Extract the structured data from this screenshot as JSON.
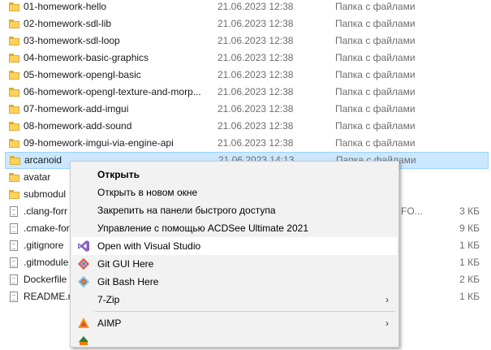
{
  "files": [
    {
      "name": "01-homework-hello",
      "date": "21.06.2023 12:38",
      "type": "Папка с файлами",
      "size": "",
      "icon": "folder-icon"
    },
    {
      "name": "02-homework-sdl-lib",
      "date": "21.06.2023 12:38",
      "type": "Папка с файлами",
      "size": "",
      "icon": "folder-icon"
    },
    {
      "name": "03-homework-sdl-loop",
      "date": "21.06.2023 12:38",
      "type": "Папка с файлами",
      "size": "",
      "icon": "folder-icon"
    },
    {
      "name": "04-homework-basic-graphics",
      "date": "21.06.2023 12:38",
      "type": "Папка с файлами",
      "size": "",
      "icon": "folder-icon"
    },
    {
      "name": "05-homework-opengl-basic",
      "date": "21.06.2023 12:38",
      "type": "Папка с файлами",
      "size": "",
      "icon": "folder-icon"
    },
    {
      "name": "06-homework-opengl-texture-and-morp...",
      "date": "21.06.2023 12:38",
      "type": "Папка с файлами",
      "size": "",
      "icon": "folder-icon"
    },
    {
      "name": "07-homework-add-imgui",
      "date": "21.06.2023 12:38",
      "type": "Папка с файлами",
      "size": "",
      "icon": "folder-icon"
    },
    {
      "name": "08-homework-add-sound",
      "date": "21.06.2023 12:38",
      "type": "Папка с файлами",
      "size": "",
      "icon": "folder-icon"
    },
    {
      "name": "09-homework-imgui-via-engine-api",
      "date": "21.06.2023 12:38",
      "type": "Папка с файлами",
      "size": "",
      "icon": "folder-icon"
    },
    {
      "name": "arcanoid",
      "date": "21.06.2023 14:13",
      "type": "Папка с файлами",
      "size": "",
      "icon": "folder-icon",
      "selected": true
    },
    {
      "name": "avatar",
      "date": "",
      "type": "",
      "size": "",
      "icon": "folder-icon"
    },
    {
      "name": "submodul",
      "date": "",
      "type": "",
      "size": "",
      "icon": "folder-icon"
    },
    {
      "name": ".clang-forr",
      "date": "",
      "type": "FO...",
      "size": "3 КБ",
      "icon": "file-icon"
    },
    {
      "name": ".cmake-for",
      "date": "",
      "type": "",
      "size": "9 КБ",
      "icon": "file-icon"
    },
    {
      "name": ".gitignore",
      "date": "",
      "type": "",
      "size": "1 КБ",
      "icon": "file-icon"
    },
    {
      "name": ".gitmodule",
      "date": "",
      "type": "",
      "size": "1 КБ",
      "icon": "file-icon"
    },
    {
      "name": "Dockerfile",
      "date": "",
      "type": "",
      "size": "2 КБ",
      "icon": "file-icon"
    },
    {
      "name": "README.m",
      "date": "",
      "type": "",
      "size": "1 КБ",
      "icon": "file-icon"
    }
  ],
  "context_menu": {
    "items": [
      {
        "label": "Открыть",
        "bold": true,
        "icon": ""
      },
      {
        "label": "Открыть в новом окне",
        "icon": ""
      },
      {
        "label": "Закрепить на панели быстрого доступа",
        "icon": ""
      },
      {
        "label": "Управление с помощью ACDSee Ultimate 2021",
        "icon": ""
      },
      {
        "label": "Open with Visual Studio",
        "icon": "visual-studio-icon",
        "hover": true
      },
      {
        "label": "Git GUI Here",
        "icon": "git-gui-icon"
      },
      {
        "label": "Git Bash Here",
        "icon": "git-bash-icon"
      },
      {
        "label": "7-Zip",
        "icon": "",
        "submenu": true
      },
      {
        "label": "AIMP",
        "icon": "aimp-icon",
        "submenu": true
      },
      {
        "label": "",
        "icon": "acdsee-icon"
      }
    ],
    "submenu_arrow": "›"
  },
  "colors": {
    "selection_bg": "#cce8ff",
    "selection_border": "#99d1ff",
    "menu_bg": "#f2f2f2",
    "vs_purple": "#865fc5"
  }
}
